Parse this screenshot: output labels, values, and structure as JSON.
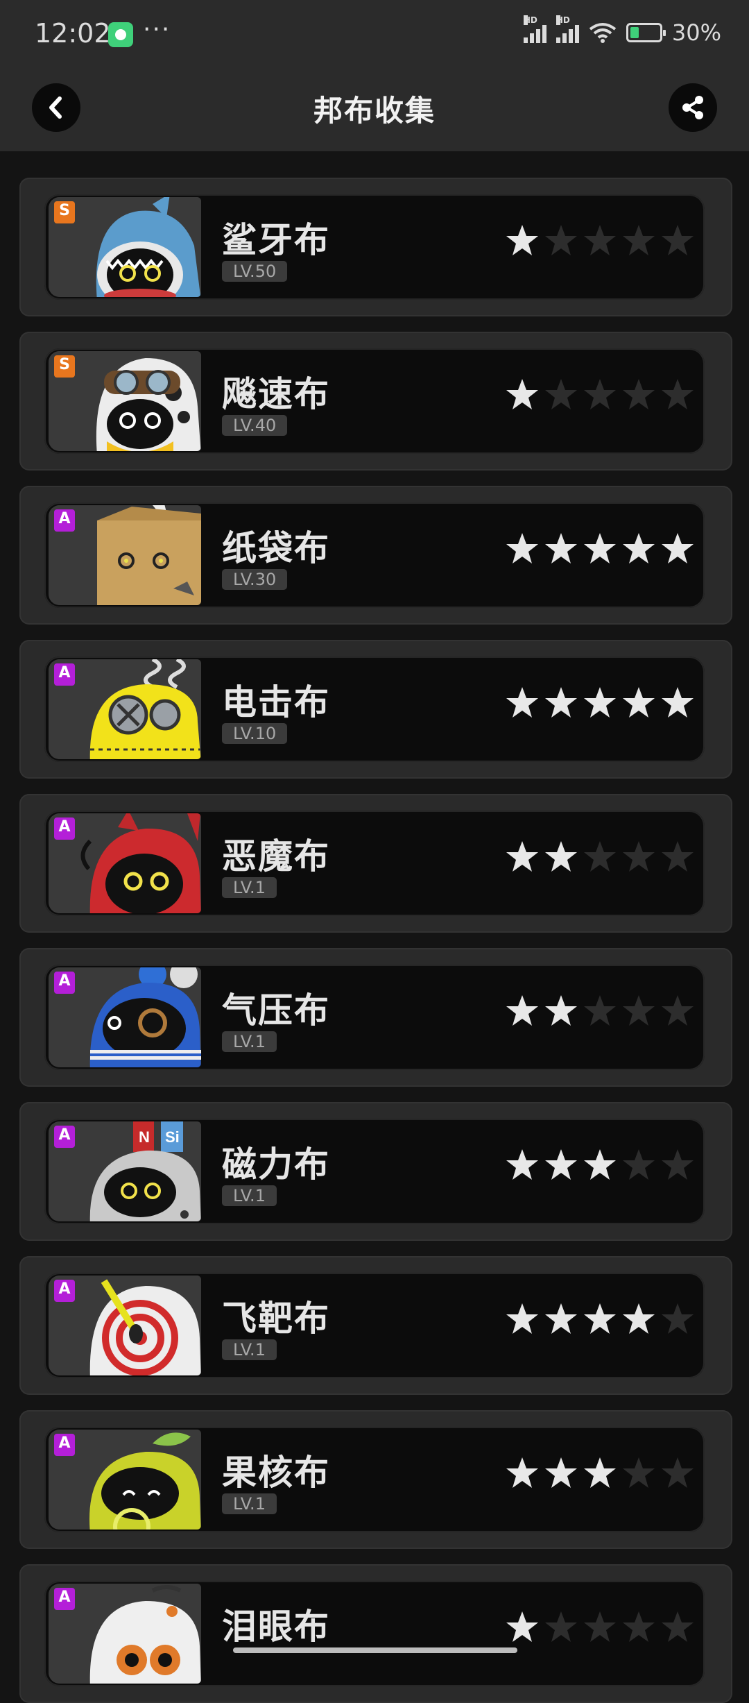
{
  "status_bar": {
    "time": "12:02",
    "dots": "···",
    "hd_label": "HD",
    "battery": "30%"
  },
  "header": {
    "title": "邦布收集",
    "back_icon": "chevron-left-icon",
    "share_icon": "share-icon"
  },
  "bangboos": [
    {
      "rank": "S",
      "name": "鲨牙布",
      "level": "LV.50",
      "stars": 1
    },
    {
      "rank": "S",
      "name": "飚速布",
      "level": "LV.40",
      "stars": 1
    },
    {
      "rank": "A",
      "name": "纸袋布",
      "level": "LV.30",
      "stars": 5
    },
    {
      "rank": "A",
      "name": "电击布",
      "level": "LV.10",
      "stars": 5
    },
    {
      "rank": "A",
      "name": "恶魔布",
      "level": "LV.1",
      "stars": 2
    },
    {
      "rank": "A",
      "name": "气压布",
      "level": "LV.1",
      "stars": 2
    },
    {
      "rank": "A",
      "name": "磁力布",
      "level": "LV.1",
      "stars": 3
    },
    {
      "rank": "A",
      "name": "飞靶布",
      "level": "LV.1",
      "stars": 4
    },
    {
      "rank": "A",
      "name": "果核布",
      "level": "LV.1",
      "stars": 3
    },
    {
      "rank": "A",
      "name": "泪眼布",
      "level": "",
      "stars": 1
    }
  ],
  "colors": {
    "rank_S": "#e8761e",
    "rank_A": "#b41fd8",
    "star_on": "#e8e8e8",
    "star_off": "#2d2d2d"
  }
}
